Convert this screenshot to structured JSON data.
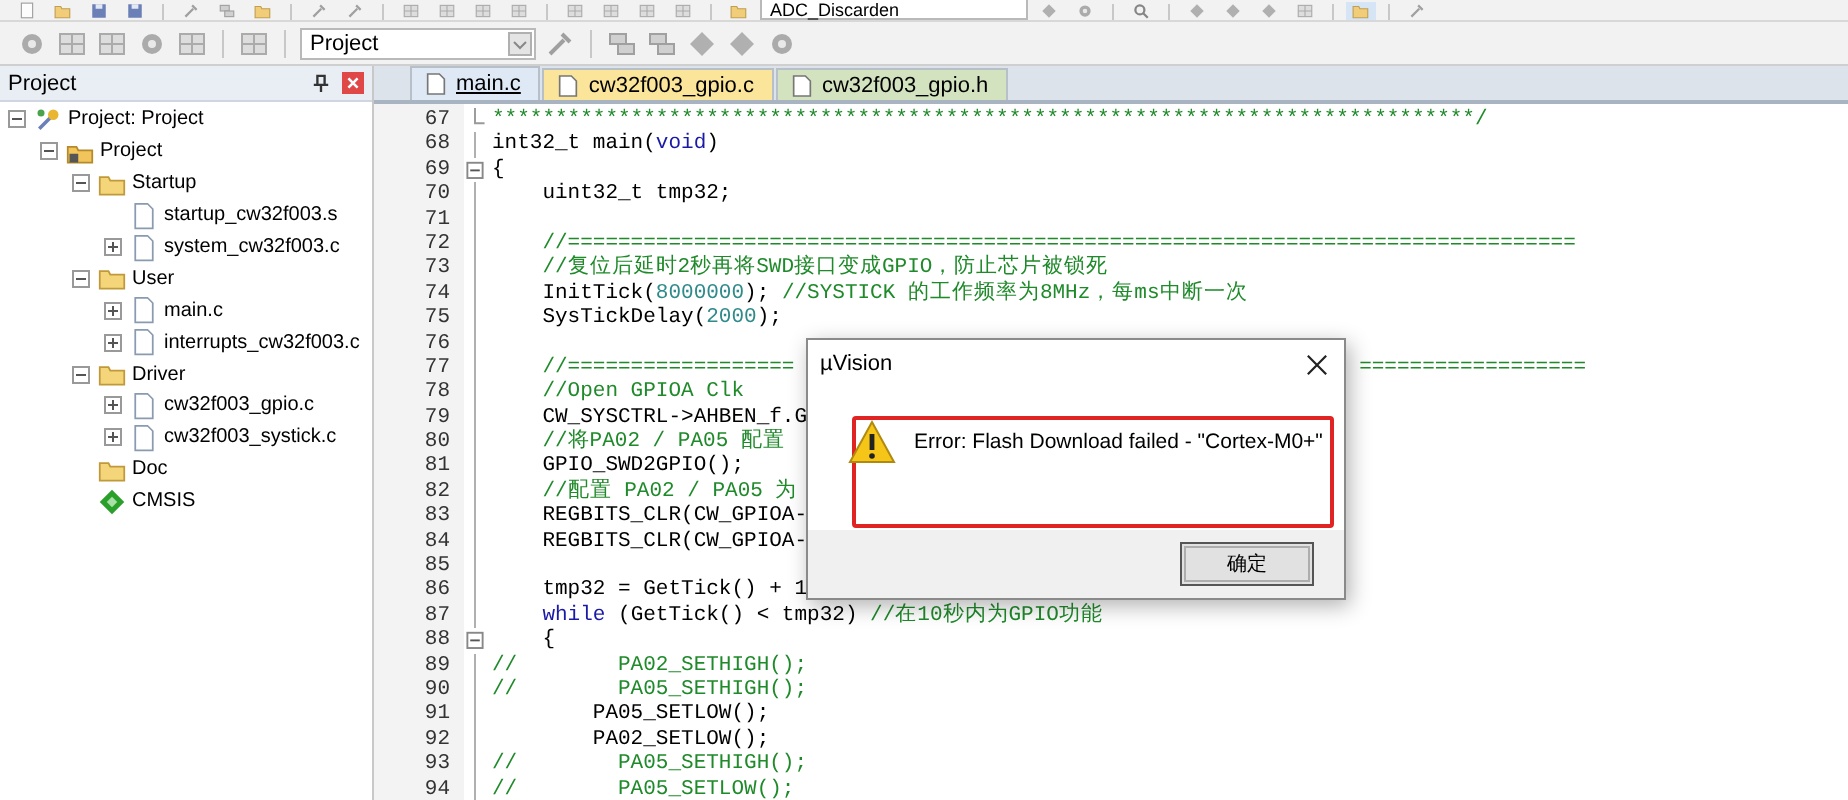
{
  "toolbar_top": {
    "combo_value": "ADC_Discarden"
  },
  "toolbar": {
    "combo_value": "Project"
  },
  "project_panel": {
    "title": "Project"
  },
  "project_tree": {
    "items": [
      {
        "label": "Project: Project",
        "kind": "target",
        "expanded": true,
        "children": [
          {
            "label": "Project",
            "kind": "group",
            "expanded": true,
            "children": [
              {
                "label": "Startup",
                "kind": "folder",
                "expanded": true,
                "children": [
                  {
                    "label": "startup_cw32f003.s",
                    "kind": "file"
                  },
                  {
                    "label": "system_cw32f003.c",
                    "kind": "file",
                    "expanded": false
                  }
                ]
              },
              {
                "label": "User",
                "kind": "folder",
                "expanded": true,
                "children": [
                  {
                    "label": "main.c",
                    "kind": "file",
                    "expanded": false
                  },
                  {
                    "label": "interrupts_cw32f003.c",
                    "kind": "file",
                    "expanded": false
                  }
                ]
              },
              {
                "label": "Driver",
                "kind": "folder",
                "expanded": true,
                "children": [
                  {
                    "label": "cw32f003_gpio.c",
                    "kind": "file",
                    "expanded": false
                  },
                  {
                    "label": "cw32f003_systick.c",
                    "kind": "file",
                    "expanded": false
                  }
                ]
              },
              {
                "label": "Doc",
                "kind": "folder"
              },
              {
                "label": "CMSIS",
                "kind": "component"
              }
            ]
          }
        ]
      }
    ]
  },
  "editor_tabs": [
    {
      "label": "main.c",
      "selected": true,
      "color": "#dfe9f6"
    },
    {
      "label": "cw32f003_gpio.c",
      "selected": false,
      "color": "#fbe59a"
    },
    {
      "label": "cw32f003_gpio.h",
      "selected": false,
      "color": "#d3e2bf"
    }
  ],
  "code_lines": [
    {
      "number": "67",
      "block_end": true,
      "segments": [
        {
          "kind": "comment",
          "text": "******************************************************************************/"
        }
      ]
    },
    {
      "number": "68",
      "segments": [
        {
          "kind": "plain",
          "text": "int32_t main("
        },
        {
          "kind": "keyword",
          "text": "void"
        },
        {
          "kind": "plain",
          "text": ")"
        }
      ]
    },
    {
      "number": "69",
      "collapsible": true,
      "segments": [
        {
          "kind": "plain",
          "text": "{"
        }
      ]
    },
    {
      "number": "70",
      "segments": [
        {
          "kind": "plain",
          "text": "    uint32_t tmp32;"
        }
      ]
    },
    {
      "number": "71"
    },
    {
      "number": "72",
      "segments": [
        {
          "kind": "comment",
          "text": "    //================================================================================"
        }
      ]
    },
    {
      "number": "73",
      "segments": [
        {
          "kind": "comment",
          "text": "    //复位后延时2秒再将SWD接口变成GPIO，防止芯片被锁死"
        }
      ]
    },
    {
      "number": "74",
      "segments": [
        {
          "kind": "plain",
          "text": "    InitTick("
        },
        {
          "kind": "number",
          "text": "8000000"
        },
        {
          "kind": "plain",
          "text": "); "
        },
        {
          "kind": "comment",
          "text": "//SYSTICK 的工作频率为8MHz，每ms中断一次"
        }
      ]
    },
    {
      "number": "75",
      "segments": [
        {
          "kind": "plain",
          "text": "    SysTickDelay("
        },
        {
          "kind": "number",
          "text": "2000"
        },
        {
          "kind": "plain",
          "text": ");"
        }
      ]
    },
    {
      "number": "76"
    },
    {
      "number": "77",
      "segments": [
        {
          "kind": "comment",
          "text": "    //=================="
        }
      ],
      "tail": [
        {
          "kind": "comment",
          "text": "=================="
        }
      ]
    },
    {
      "number": "78",
      "segments": [
        {
          "kind": "comment",
          "text": "    //Open GPIOA Clk"
        }
      ]
    },
    {
      "number": "79",
      "segments": [
        {
          "kind": "plain",
          "text": "    CW_SYSCTRL->AHBEN_f.G"
        }
      ]
    },
    {
      "number": "80",
      "segments": [
        {
          "kind": "comment",
          "text": "    //将PA02 / PA05 配置"
        }
      ]
    },
    {
      "number": "81",
      "segments": [
        {
          "kind": "plain",
          "text": "    GPIO_SWD2GPIO();"
        }
      ]
    },
    {
      "number": "82",
      "segments": [
        {
          "kind": "comment",
          "text": "    //配置 PA02 / PA05 为"
        }
      ]
    },
    {
      "number": "83",
      "segments": [
        {
          "kind": "plain",
          "text": "    REGBITS_CLR(CW_GPIOA-"
        }
      ]
    },
    {
      "number": "84",
      "segments": [
        {
          "kind": "plain",
          "text": "    REGBITS_CLR(CW_GPIOA-"
        }
      ]
    },
    {
      "number": "85"
    },
    {
      "number": "86",
      "segments": [
        {
          "kind": "plain",
          "text": "    tmp32 = GetTick() + 1"
        }
      ]
    },
    {
      "number": "87",
      "segments": [
        {
          "kind": "keyword",
          "text": "    while"
        },
        {
          "kind": "plain",
          "text": " (GetTick() < tmp32) "
        },
        {
          "kind": "comment",
          "text": "//在10秒内为GPIO功能"
        }
      ]
    },
    {
      "number": "88",
      "collapsible": true,
      "segments": [
        {
          "kind": "plain",
          "text": "    {"
        }
      ]
    },
    {
      "number": "89",
      "segments": [
        {
          "kind": "comment",
          "text": "//        PA02_SETHIGH();"
        }
      ]
    },
    {
      "number": "90",
      "segments": [
        {
          "kind": "comment",
          "text": "//        PA05_SETHIGH();"
        }
      ]
    },
    {
      "number": "91",
      "segments": [
        {
          "kind": "plain",
          "text": "        PA05_SETLOW();"
        }
      ]
    },
    {
      "number": "92",
      "segments": [
        {
          "kind": "plain",
          "text": "        PA02_SETLOW();"
        }
      ]
    },
    {
      "number": "93",
      "segments": [
        {
          "kind": "comment",
          "text": "//        PA05_SETHIGH();"
        }
      ]
    },
    {
      "number": "94",
      "segments": [
        {
          "kind": "comment",
          "text": "//        PA05_SETLOW();"
        }
      ]
    }
  ],
  "dialog": {
    "title": "µVision",
    "message": "Error: Flash Download failed  -  \"Cortex-M0+\"",
    "highlighted": true,
    "button": "确定"
  }
}
